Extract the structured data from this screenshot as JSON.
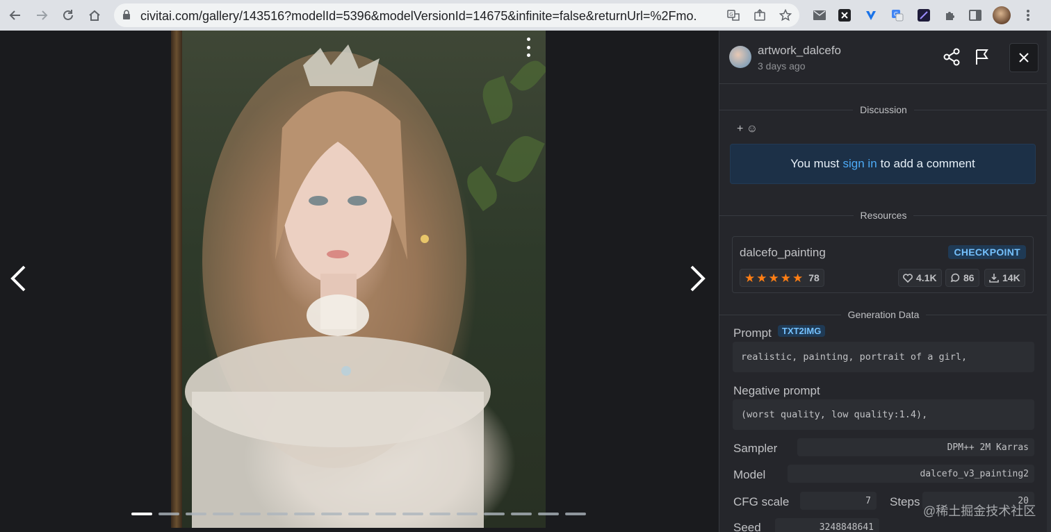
{
  "browser": {
    "url": "civitai.com/gallery/143516?modelId=5396&modelVersionId=14675&infinite=false&returnUrl=%2Fmo...",
    "nav_icons": [
      "back-icon",
      "forward-icon",
      "reload-icon",
      "home-icon"
    ]
  },
  "viewer": {
    "prev_arrow": "‹",
    "next_arrow": "›",
    "dots_total": 17,
    "active_dot": 0
  },
  "header": {
    "username": "artwork_dalcefo",
    "time": "3 days ago"
  },
  "discussion": {
    "title": "Discussion",
    "reaction": "+ ☺",
    "signin_prefix": "You must",
    "signin_link": "sign in",
    "signin_suffix": "to add a comment"
  },
  "resources": {
    "title": "Resources",
    "name": "dalcefo_painting",
    "type": "CHECKPOINT",
    "stars": 5,
    "rating_count": "78",
    "likes": "4.1K",
    "comments": "86",
    "downloads": "14K"
  },
  "generation": {
    "title": "Generation Data",
    "prompt_label": "Prompt",
    "prompt_tag": "TXT2IMG",
    "prompt": "realistic, painting, portrait of a girl,",
    "negative_label": "Negative prompt",
    "negative": "(worst quality, low quality:1.4),",
    "sampler_label": "Sampler",
    "sampler": "DPM++ 2M Karras",
    "model_label": "Model",
    "model": "dalcefo_v3_painting2",
    "cfg_label": "CFG scale",
    "cfg": "7",
    "steps_label": "Steps",
    "steps": "20",
    "seed_label": "Seed",
    "seed": "3248848641"
  },
  "watermark": "@稀土掘金技术社区",
  "colors": {
    "accent": "#4dabf7",
    "badge_bg": "#1f3a55",
    "star": "#fd7e14",
    "panel_bg": "#25262b"
  }
}
